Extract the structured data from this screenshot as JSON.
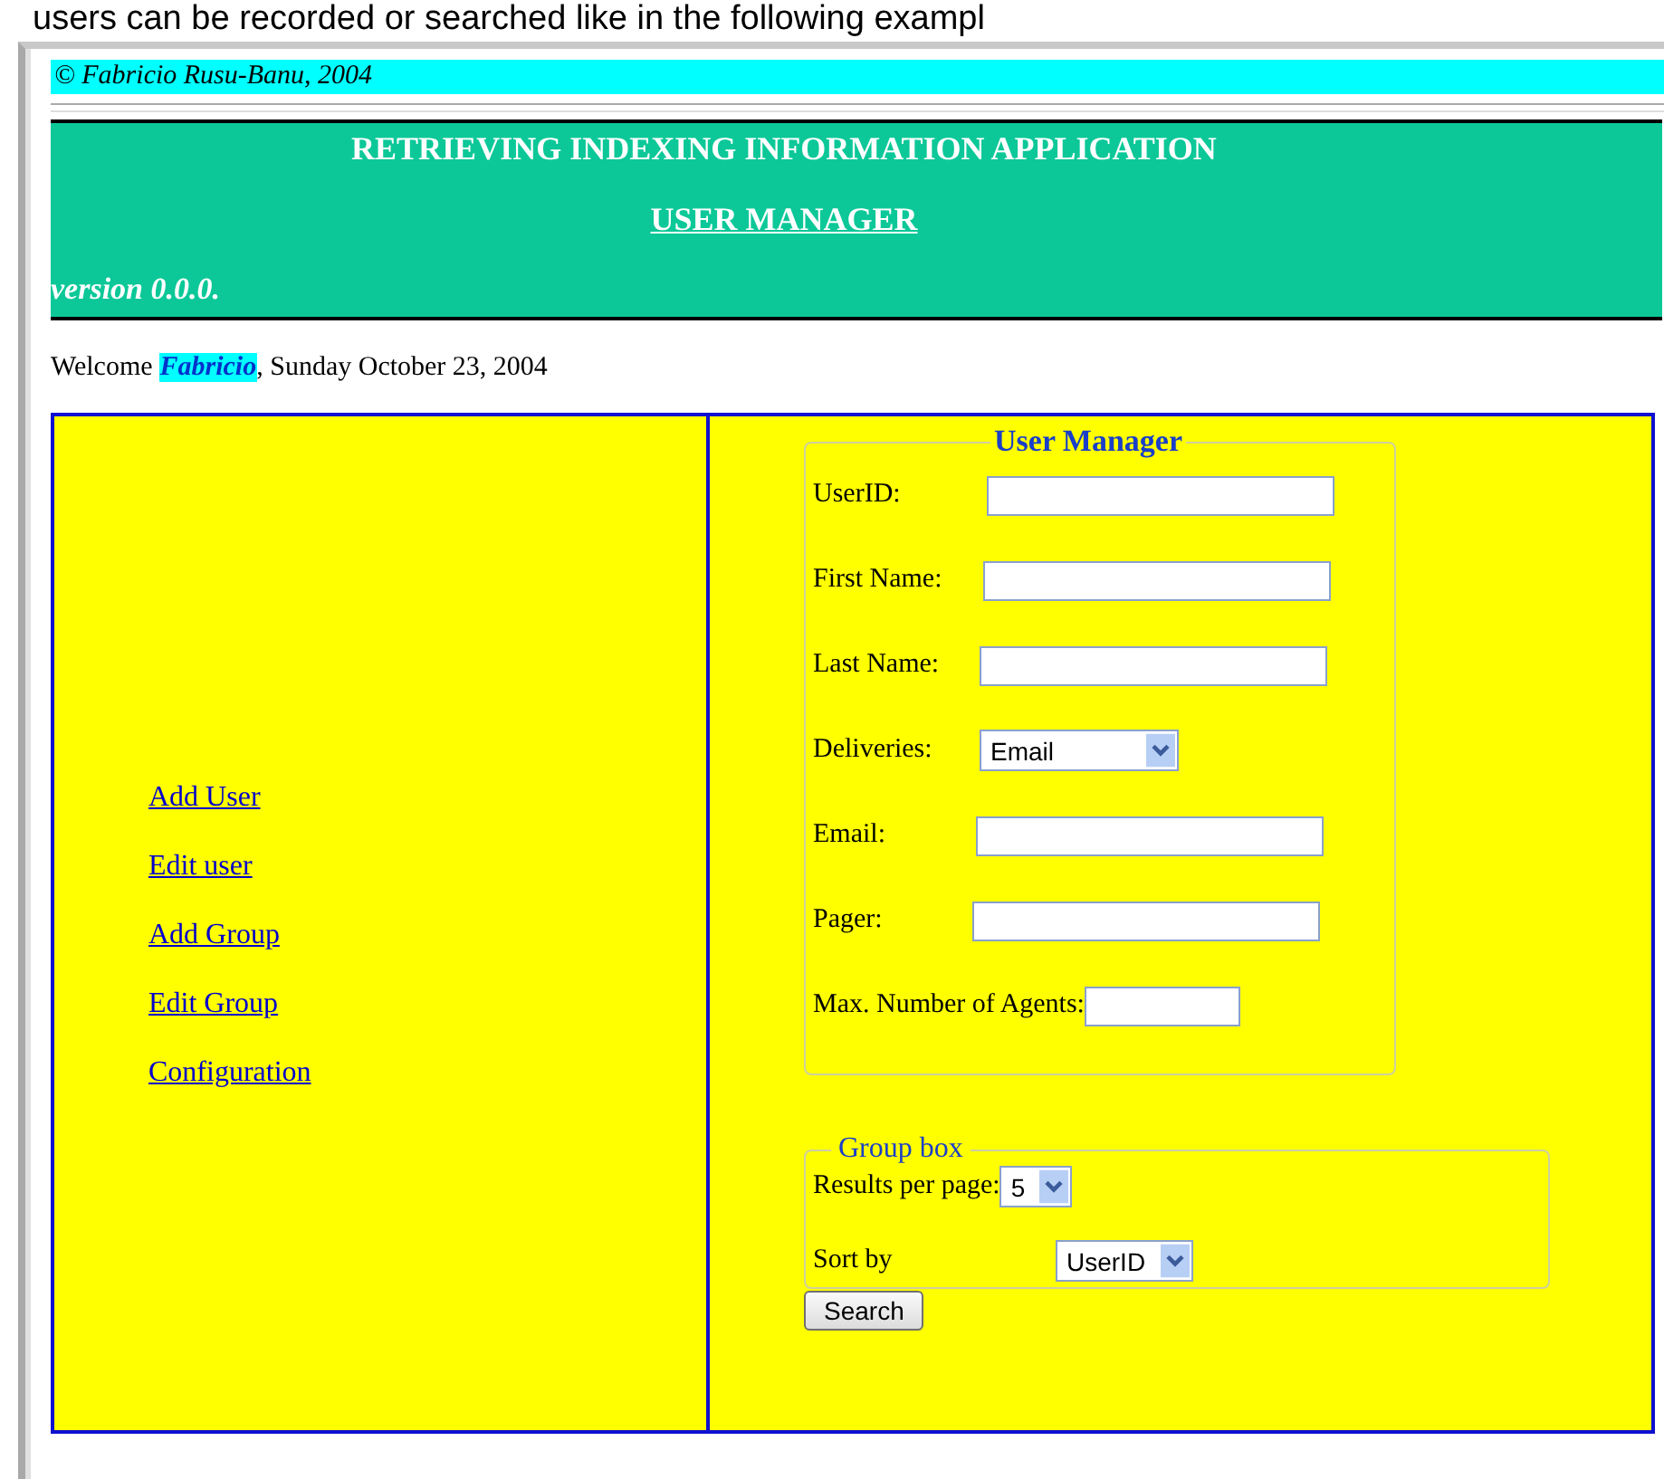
{
  "caption": "users can be recorded or searched like in the following exampl",
  "copyright": "© Fabricio Rusu-Banu, 2004",
  "header": {
    "title": "RETRIEVING INDEXING INFORMATION APPLICATION",
    "subtitle": "USER MANAGER",
    "version": "version 0.0.0."
  },
  "welcome": {
    "prefix": "Welcome",
    "name": "Fabricio",
    "suffix": ", Sunday October 23, 2004"
  },
  "nav_links": [
    "Add User",
    "Edit user",
    "Add Group",
    "Edit Group",
    "Configuration"
  ],
  "user_manager": {
    "legend": "User Manager",
    "fields": [
      {
        "kind": "text",
        "label": "UserID:"
      },
      {
        "kind": "text",
        "label": "First Name:"
      },
      {
        "kind": "text",
        "label": "Last Name:"
      },
      {
        "kind": "select",
        "label": "Deliveries:",
        "value": "Email"
      },
      {
        "kind": "text",
        "label": "Email:"
      },
      {
        "kind": "text",
        "label": "Pager:"
      },
      {
        "kind": "short",
        "label": "Max. Number of Agents:"
      }
    ]
  },
  "group_box": {
    "legend": "Group box",
    "fields": [
      {
        "label": "Results per page:",
        "value": "5"
      },
      {
        "label": "Sort by",
        "value": "UserID"
      }
    ]
  },
  "search_button": "Search"
}
